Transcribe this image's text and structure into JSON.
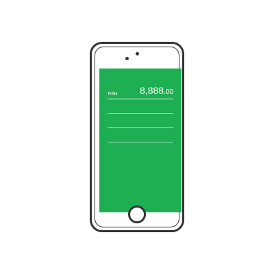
{
  "screen": {
    "today_label": "Today",
    "amount_main": "8,888",
    "amount_cents": ".00"
  },
  "colors": {
    "screen_green": "#1eaf52",
    "outline": "#333333"
  },
  "icons": {
    "front_camera": "camera-icon",
    "home": "home-button-icon"
  }
}
